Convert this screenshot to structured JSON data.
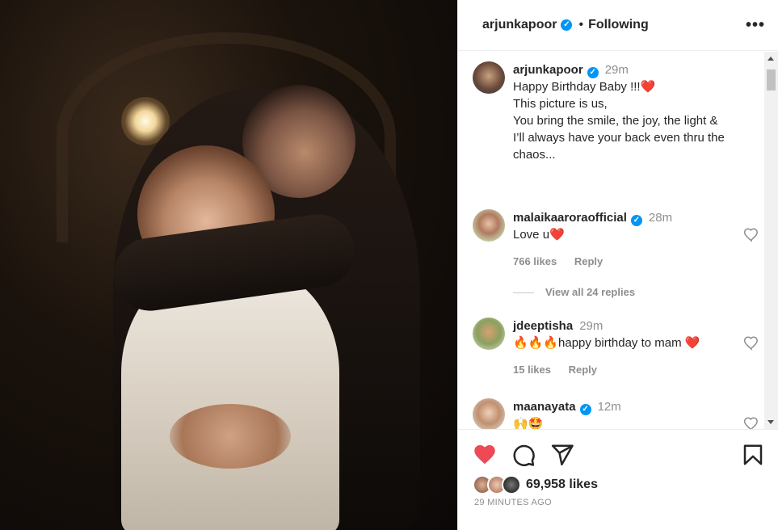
{
  "header": {
    "username": "arjunkapoor",
    "separator": "•",
    "follow_status": "Following",
    "more_label": "•••"
  },
  "caption": {
    "username": "arjunkapoor",
    "time": "29m",
    "lines": [
      "Happy Birthday Baby !!!❤️",
      "This picture is us,",
      "You bring the smile, the joy, the light &",
      "I’ll always have your back even thru the",
      "chaos..."
    ]
  },
  "comments": [
    {
      "username": "malaikaaroraofficial",
      "time": "28m",
      "text": "Love u❤️",
      "likes": "766 likes",
      "reply": "Reply",
      "view_replies": "View all 24 replies"
    },
    {
      "username": "jdeeptisha",
      "time": "29m",
      "text": "🔥🔥🔥happy birthday to mam ❤️",
      "likes": "15 likes",
      "reply": "Reply"
    },
    {
      "username": "maanayata",
      "time": "12m",
      "text": "🙌🤩"
    }
  ],
  "footer": {
    "likes": "69,958 likes",
    "time_ago": "29 MINUTES AGO"
  },
  "colors": {
    "like_red": "#ed4956",
    "verified_blue": "#0095f6",
    "muted_text": "#8e8e8e"
  }
}
